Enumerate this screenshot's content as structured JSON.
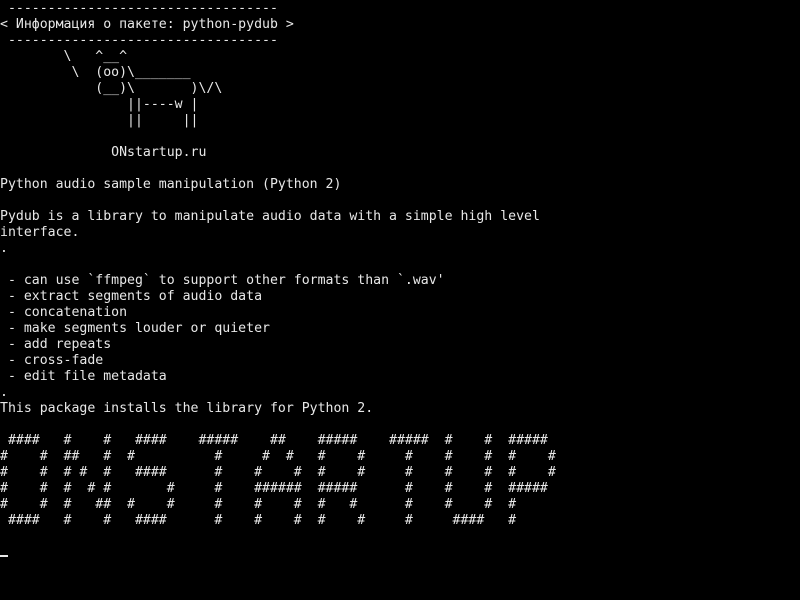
{
  "terminal": {
    "foreground": "#e8e8e8",
    "background": "#000000",
    "lines": [
      " ----------------------------------",
      "< Информация о пакете: python-pydub >",
      " ----------------------------------",
      "        \\   ^__^",
      "         \\  (oo)\\_______",
      "            (__)\\       )\\/\\",
      "                ||----w |",
      "                ||     ||",
      "",
      "              ONstartup.ru",
      "",
      "Python audio sample manipulation (Python 2)",
      "",
      "Pydub is a library to manipulate audio data with a simple high level",
      "interface.",
      ".",
      "",
      " - can use `ffmpeg` to support other formats than `.wav'",
      " - extract segments of audio data",
      " - concatenation",
      " - make segments louder or quieter",
      " - add repeats",
      " - cross-fade",
      " - edit file metadata",
      ".",
      "This package installs the library for Python 2.",
      "",
      " ####   #    #   ####    #####    ##    #####    #####  #    #  #####",
      "#    #  ##   #  #          #     #  #   #    #     #    #    #  #    #",
      "#    #  # #  #   ####      #    #    #  #    #     #    #    #  #    #",
      "#    #  #  # #       #     #    ######  #####      #    #    #  #####",
      "#    #  #   ##  #    #     #    #    #  #   #      #    #    #  #",
      " ####   #    #   ####      #    #    #  #    #     #     ####   #"
    ]
  }
}
